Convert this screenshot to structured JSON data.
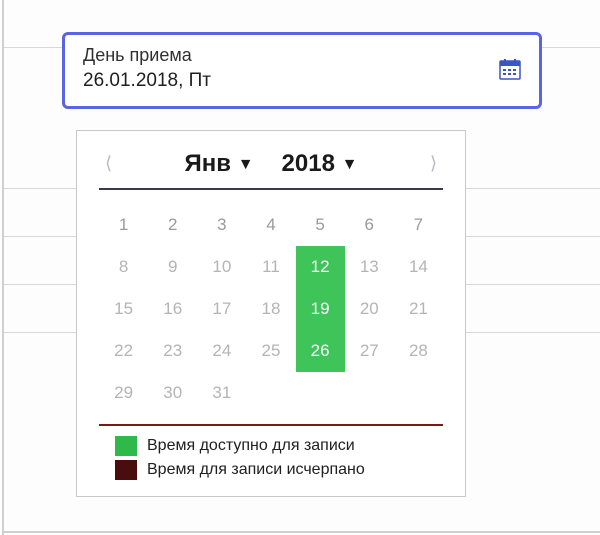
{
  "field": {
    "label": "День приема",
    "value": "26.01.2018, Пт"
  },
  "calendar": {
    "month_label": "Янв",
    "year_label": "2018",
    "weekdays": [
      "1",
      "2",
      "3",
      "4",
      "5",
      "6",
      "7"
    ],
    "weeks": [
      [
        {
          "d": "8"
        },
        {
          "d": "9"
        },
        {
          "d": "10"
        },
        {
          "d": "11"
        },
        {
          "d": "12",
          "avail": true
        },
        {
          "d": "13"
        },
        {
          "d": "14"
        }
      ],
      [
        {
          "d": "15"
        },
        {
          "d": "16"
        },
        {
          "d": "17"
        },
        {
          "d": "18"
        },
        {
          "d": "19",
          "avail": true
        },
        {
          "d": "20"
        },
        {
          "d": "21"
        }
      ],
      [
        {
          "d": "22"
        },
        {
          "d": "23"
        },
        {
          "d": "24"
        },
        {
          "d": "25"
        },
        {
          "d": "26",
          "avail": true
        },
        {
          "d": "27"
        },
        {
          "d": "28"
        }
      ],
      [
        {
          "d": "29"
        },
        {
          "d": "30"
        },
        {
          "d": "31"
        },
        {
          "d": ""
        },
        {
          "d": ""
        },
        {
          "d": ""
        },
        {
          "d": ""
        }
      ]
    ]
  },
  "legend": {
    "available": "Время доступно для записи",
    "full": "Время для записи исчерпано"
  },
  "colors": {
    "focus_border": "#5a64e6",
    "available_bg": "#3fc45a",
    "full_bg": "#4a0d0d"
  }
}
